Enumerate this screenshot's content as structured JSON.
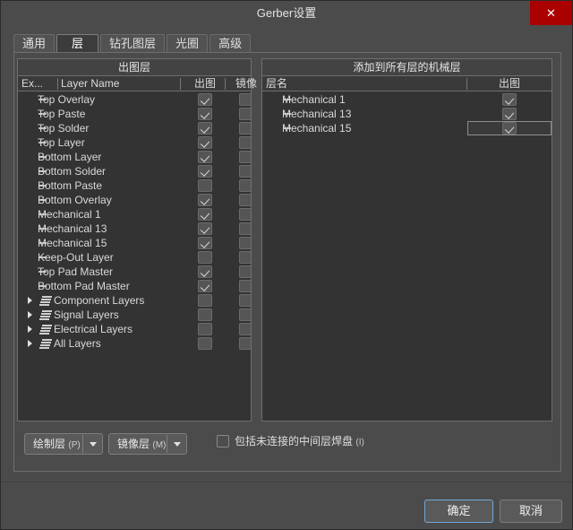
{
  "window": {
    "title": "Gerber设置",
    "close_label": "✕"
  },
  "tabs": [
    {
      "label": "通用",
      "active": false
    },
    {
      "label": "层",
      "active": true
    },
    {
      "label": "钻孔图层",
      "active": false
    },
    {
      "label": "光圈",
      "active": false
    },
    {
      "label": "高级",
      "active": false
    }
  ],
  "left_panel": {
    "title": "出图层",
    "columns": [
      "Ex...",
      "Layer Name",
      "出图",
      "镜像"
    ],
    "rows": [
      {
        "name": "Top Overlay",
        "type": "layer",
        "plot": true,
        "mirror": false
      },
      {
        "name": "Top Paste",
        "type": "layer",
        "plot": true,
        "mirror": false
      },
      {
        "name": "Top Solder",
        "type": "layer",
        "plot": true,
        "mirror": false
      },
      {
        "name": "Top Layer",
        "type": "layer",
        "plot": true,
        "mirror": false
      },
      {
        "name": "Bottom Layer",
        "type": "layer",
        "plot": true,
        "mirror": false
      },
      {
        "name": "Bottom Solder",
        "type": "layer",
        "plot": true,
        "mirror": false
      },
      {
        "name": "Bottom Paste",
        "type": "layer",
        "plot": false,
        "mirror": false
      },
      {
        "name": "Bottom Overlay",
        "type": "layer",
        "plot": true,
        "mirror": false
      },
      {
        "name": "Mechanical 1",
        "type": "layer",
        "plot": true,
        "mirror": false
      },
      {
        "name": "Mechanical 13",
        "type": "layer",
        "plot": true,
        "mirror": false
      },
      {
        "name": "Mechanical 15",
        "type": "layer",
        "plot": true,
        "mirror": false
      },
      {
        "name": "Keep-Out Layer",
        "type": "layer",
        "plot": false,
        "mirror": false
      },
      {
        "name": "Top Pad Master",
        "type": "layer",
        "plot": true,
        "mirror": false
      },
      {
        "name": "Bottom Pad Master",
        "type": "layer",
        "plot": true,
        "mirror": false
      },
      {
        "name": "Component Layers",
        "type": "group",
        "plot": false,
        "mirror": false
      },
      {
        "name": "Signal Layers",
        "type": "group",
        "plot": false,
        "mirror": false
      },
      {
        "name": "Electrical Layers",
        "type": "group",
        "plot": false,
        "mirror": false
      },
      {
        "name": "All Layers",
        "type": "group",
        "plot": false,
        "mirror": false
      }
    ]
  },
  "right_panel": {
    "title": "添加到所有层的机械层",
    "columns": [
      "层名",
      "出图"
    ],
    "rows": [
      {
        "name": "Mechanical 1",
        "plot": true,
        "selected": false
      },
      {
        "name": "Mechanical 13",
        "plot": true,
        "selected": false
      },
      {
        "name": "Mechanical 15",
        "plot": true,
        "selected": true
      }
    ]
  },
  "bottom_controls": {
    "plot_layers_button": {
      "label": "绘制层",
      "mnemonic": "(P)"
    },
    "mirror_layers_button": {
      "label": "镜像层",
      "mnemonic": "(M)"
    },
    "include_pads_checkbox": {
      "label": "包括未连接的中间层焊盘",
      "mnemonic": "(I)",
      "checked": false
    }
  },
  "footer": {
    "ok_label": "确定",
    "cancel_label": "取消"
  },
  "colors": {
    "dialog_bg": "#4b4b4b",
    "panel_bg": "#333333",
    "close_red": "#aa0000",
    "focus_blue": "#6fa8dc"
  }
}
